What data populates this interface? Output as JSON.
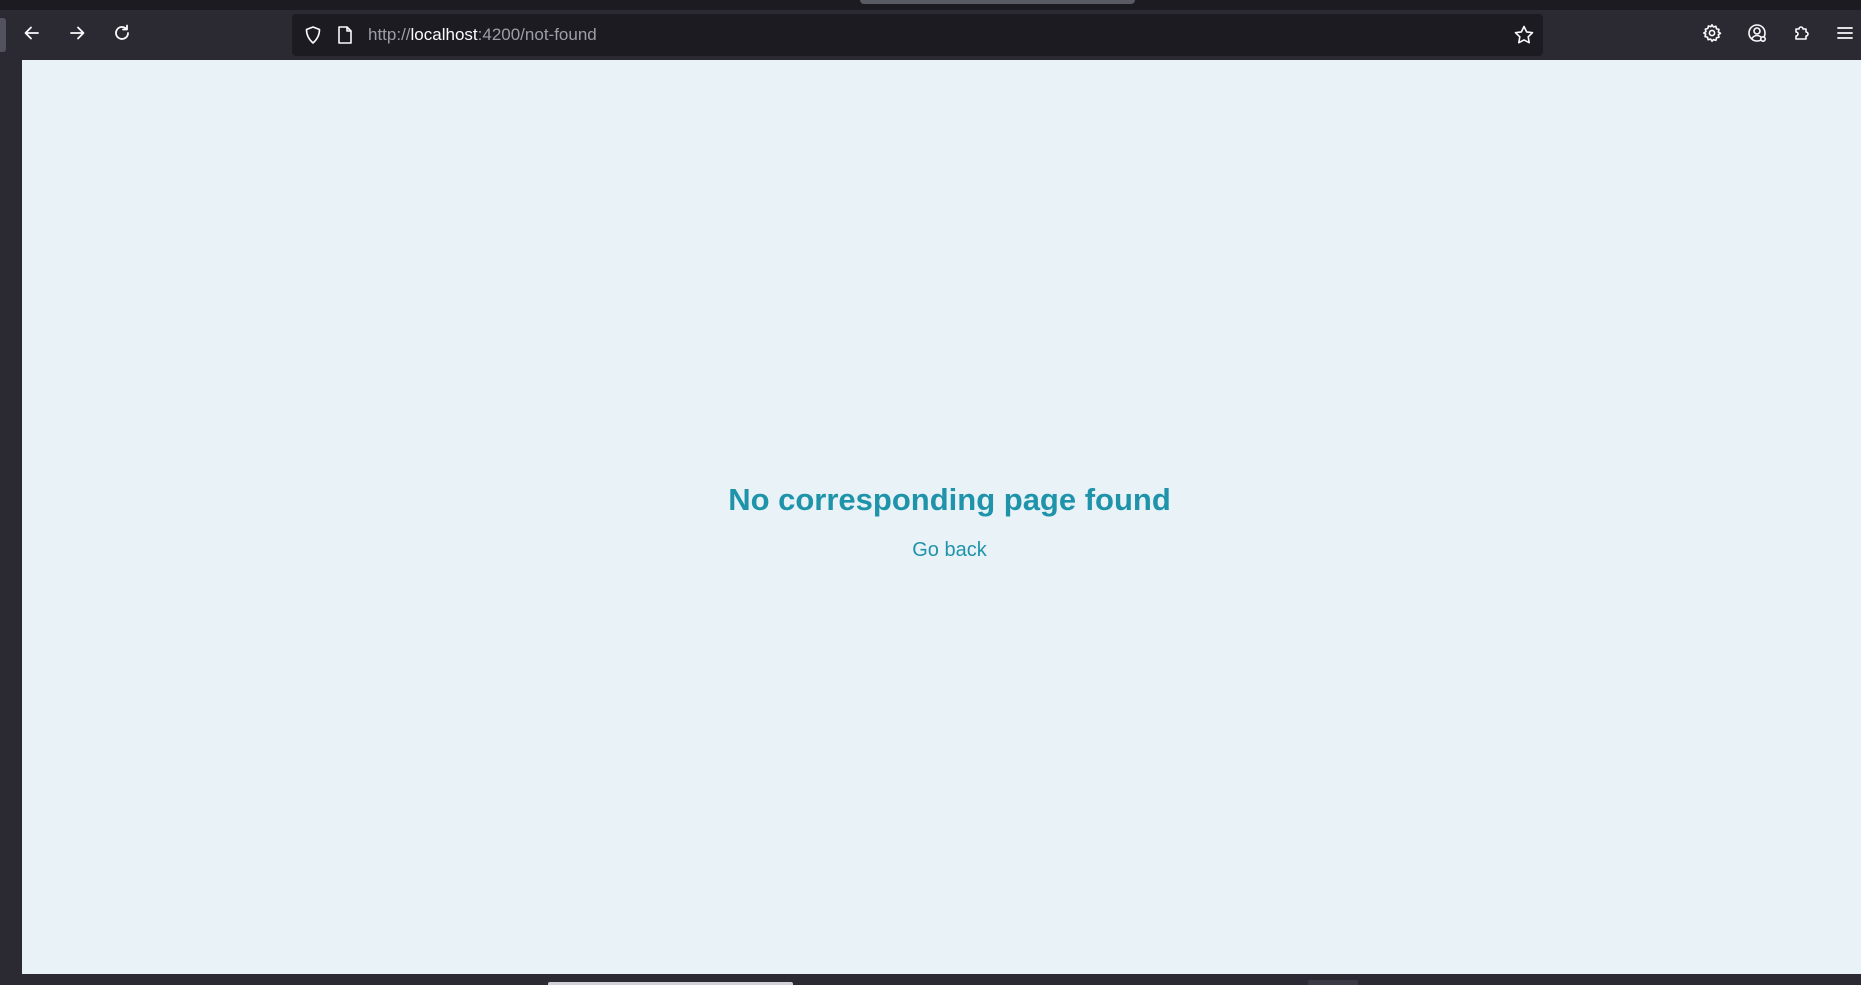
{
  "browser": {
    "url_protocol": "http://",
    "url_host": "localhost",
    "url_path": ":4200/not-found"
  },
  "page": {
    "title": "No corresponding page found",
    "back_link": "Go back"
  },
  "colors": {
    "accent": "#1f93aa",
    "page_background": "#e8f2f7",
    "browser_chrome": "#2b2a33"
  },
  "icons": {
    "back": "back-arrow-icon",
    "forward": "forward-arrow-icon",
    "reload": "reload-icon",
    "tracking": "shield-icon",
    "page": "page-icon",
    "bookmark": "star-icon",
    "settings": "gear-icon",
    "account": "account-icon",
    "extensions": "puzzle-icon",
    "menu": "hamburger-menu-icon"
  }
}
